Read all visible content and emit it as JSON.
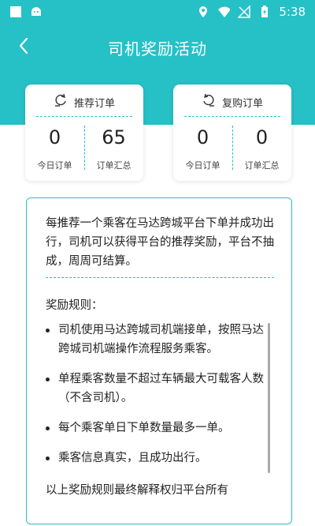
{
  "status_bar": {
    "time": "5:38",
    "icons": [
      "square-icon",
      "android-icon",
      "location-icon",
      "wifi-icon",
      "no-signal-icon",
      "battery-charging-icon"
    ]
  },
  "nav": {
    "title": "司机奖励活动",
    "back_icon": "chevron-left-icon"
  },
  "cards": [
    {
      "title": "推荐订单",
      "icon": "recommend-refresh-icon",
      "today_value": "0",
      "today_label": "今日订单",
      "total_value": "65",
      "total_label": "订单汇总"
    },
    {
      "title": "复购订单",
      "icon": "repurchase-refresh-icon",
      "today_value": "0",
      "today_label": "今日订单",
      "total_value": "0",
      "total_label": "订单汇总"
    }
  ],
  "intro": "每推荐一个乘客在马达跨城平台下单并成功出行，司机可以获得平台的推荐奖励，平台不抽成，周周可结算。",
  "rules_title": "奖励规则：",
  "rules": [
    "司机使用马达跨城司机端接单，按照马达跨城司机端操作流程服务乘客。",
    "单程乘客数量不超过车辆最大可载客人数（不含司机）。",
    "每个乘客单日下单数量最多一单。",
    "乘客信息真实，且成功出行。"
  ],
  "footer_note": "以上奖励规则最终解释权归平台所有",
  "colors": {
    "accent": "#25c1c6",
    "text": "#222222"
  }
}
